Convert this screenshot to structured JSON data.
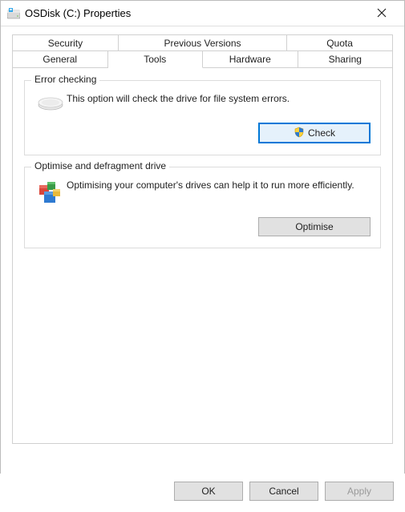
{
  "window": {
    "title": "OSDisk (C:) Properties"
  },
  "tabs": {
    "row1": [
      "Security",
      "Previous Versions",
      "Quota"
    ],
    "row2": [
      "General",
      "Tools",
      "Hardware",
      "Sharing"
    ],
    "active": "Tools"
  },
  "groups": {
    "errorChecking": {
      "legend": "Error checking",
      "text": "This option will check the drive for file system errors.",
      "button": "Check"
    },
    "optimise": {
      "legend": "Optimise and defragment drive",
      "text": "Optimising your computer's drives can help it to run more efficiently.",
      "button": "Optimise"
    }
  },
  "footer": {
    "ok": "OK",
    "cancel": "Cancel",
    "apply": "Apply"
  }
}
